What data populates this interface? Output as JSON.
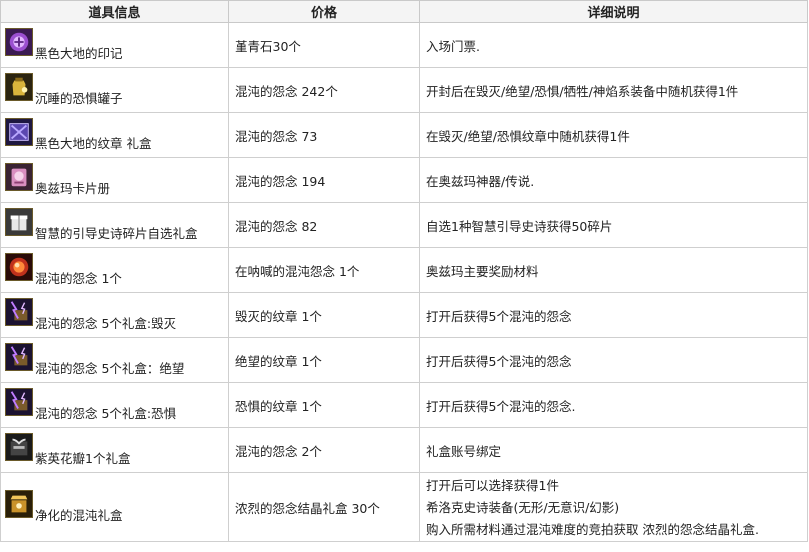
{
  "headers": {
    "item": "道具信息",
    "price": "价格",
    "desc": "详细说明"
  },
  "rows": [
    {
      "name": "黑色大地的印记",
      "icon": "purple-seal-icon",
      "price": "堇青石30个",
      "desc": [
        "入场门票."
      ]
    },
    {
      "name": "沉睡的恐惧罐子",
      "icon": "golden-jar-icon",
      "price": "混沌的怨念 242个",
      "desc": [
        "开封后在毁灭/绝望/恐惧/牺牲/神焰系装备中随机获得1件"
      ]
    },
    {
      "name": "黑色大地的纹章 礼盒",
      "icon": "purple-emblem-box-icon",
      "price": "混沌的怨念 73",
      "desc": [
        "在毁灭/绝望/恐惧纹章中随机获得1件"
      ]
    },
    {
      "name": "奥兹玛卡片册",
      "icon": "pink-card-album-icon",
      "price": "混沌的怨念 194",
      "desc": [
        "在奥兹玛神器/传说."
      ]
    },
    {
      "name": "智慧的引导史诗碎片自选礼盒",
      "icon": "white-gift-box-icon",
      "price": "混沌的怨念 82",
      "desc": [
        "自选1种智慧引导史诗获得50碎片"
      ]
    },
    {
      "name": "混沌的怨念 1个",
      "icon": "red-orb-icon",
      "price": "在呐喊的混沌怨念 1个",
      "desc": [
        "奥兹玛主要奖励材料"
      ]
    },
    {
      "name": "混沌的怨念 5个礼盒:毁灭",
      "icon": "purple-lightning-box-icon",
      "price": "毁灭的纹章 1个",
      "desc": [
        "打开后获得5个混沌的怨念"
      ]
    },
    {
      "name": "混沌的怨念 5个礼盒：绝望",
      "icon": "purple-lightning-box-icon",
      "price": "绝望的纹章 1个",
      "desc": [
        "打开后获得5个混沌的怨念"
      ]
    },
    {
      "name": "混沌的怨念 5个礼盒:恐惧",
      "icon": "purple-lightning-box-icon",
      "price": "恐惧的纹章 1个",
      "desc": [
        "打开后获得5个混沌的怨念."
      ]
    },
    {
      "name": "紫英花瓣1个礼盒",
      "icon": "dark-petal-box-icon",
      "price": "混沌的怨念 2个",
      "desc": [
        "礼盒账号绑定"
      ]
    },
    {
      "name": "净化的混沌礼盒",
      "icon": "golden-chaos-box-icon",
      "price": "浓烈的怨念结晶礼盒 30个",
      "desc": [
        "打开后可以选择获得1件",
        "希洛克史诗装备(无形/无意识/幻影)",
        "购入所需材料通过混沌难度的竞拍获取 浓烈的怨念结晶礼盒."
      ]
    }
  ]
}
